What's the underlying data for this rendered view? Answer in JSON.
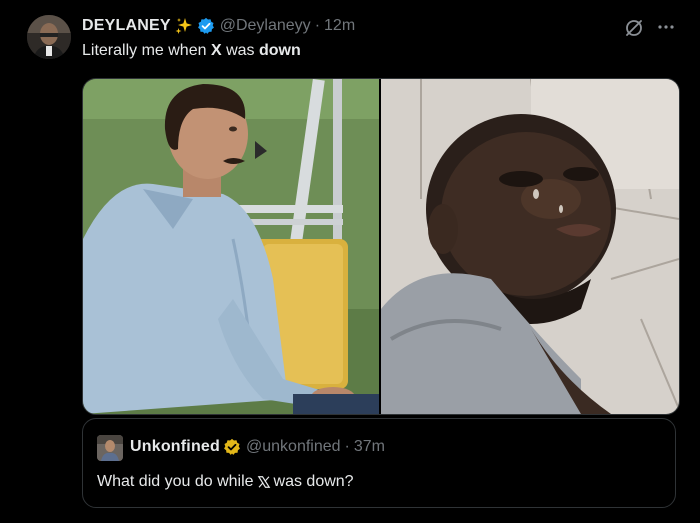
{
  "tweet": {
    "author_name": "DEYLANEY",
    "handle": "@Deylaneyy",
    "separator": "·",
    "time": "12m",
    "text_before": "Literally me when ",
    "text_bold_1": "X",
    "text_middle": " was ",
    "text_bold_2": "down"
  },
  "quote": {
    "author_name": "Unkonfined",
    "handle": "@unkonfined",
    "separator": "·",
    "time": "37m",
    "text_before": "What did you do while ",
    "text_after": " was down?"
  },
  "icons": {
    "sparkle": "sparkles-icon",
    "verified": "verified-badge-icon",
    "grok": "grok-icon",
    "more": "more-icon",
    "x_logo": "x-logo-icon"
  },
  "colors": {
    "background": "#000000",
    "text": "#e7e9ea",
    "secondary": "#71767b",
    "verified_blue": "#1d9bf0",
    "verified_gold": "#e2b719",
    "border": "#2f3336"
  }
}
